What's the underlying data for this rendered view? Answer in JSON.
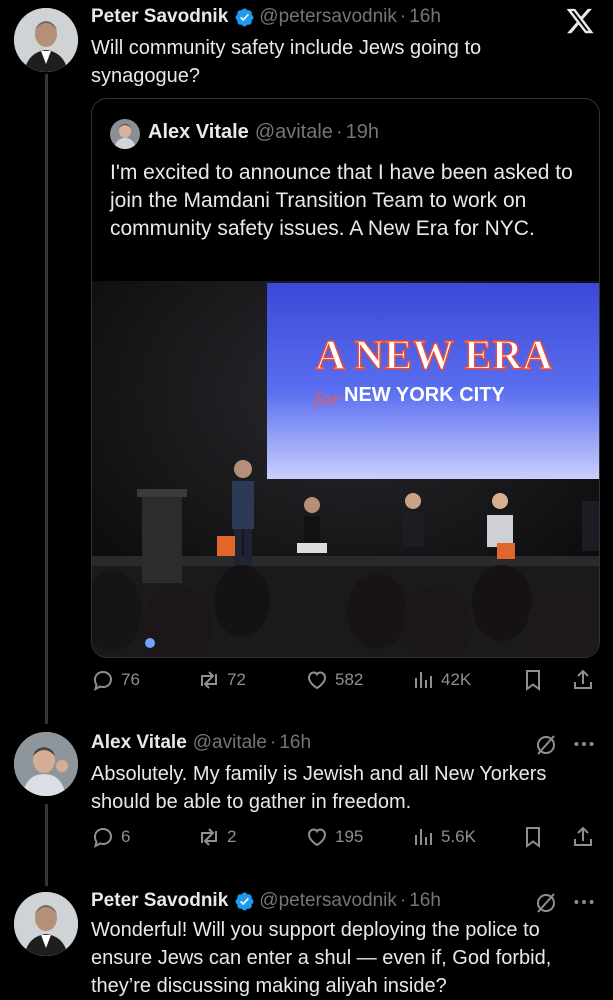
{
  "thread": {
    "main_post": {
      "author_name": "Peter Savodnik",
      "handle": "@petersavodnik",
      "separator": "·",
      "time": "16h",
      "text": "Will community safety include Jews going to synagogue?",
      "verified": true,
      "quoted_post": {
        "author_name": "Alex Vitale",
        "handle": "@avitale",
        "separator": "·",
        "time": "19h",
        "text": "I'm excited to announce that I have been asked to join the Mamdani Transition Team to work on community safety issues. A New Era for NYC.",
        "image": {
          "screen_headline": "A NEW ERA",
          "screen_script": "for",
          "screen_subline": "NEW YORK CITY"
        }
      },
      "stats": {
        "replies": "76",
        "reposts": "72",
        "likes": "582",
        "views": "42K"
      }
    },
    "reply_1": {
      "author_name": "Alex Vitale",
      "handle": "@avitale",
      "separator": "·",
      "time": "16h",
      "text": "Absolutely. My family is Jewish and all New Yorkers should be able to gather in freedom.",
      "stats": {
        "replies": "6",
        "reposts": "2",
        "likes": "195",
        "views": "5.6K"
      }
    },
    "reply_2": {
      "author_name": "Peter Savodnik",
      "handle": "@petersavodnik",
      "separator": "·",
      "time": "16h",
      "verified": true,
      "text": "Wonderful! Will you support deploying the police to ensure Jews can enter a shul — even if, God forbid, they’re discussing making aliyah inside?"
    }
  },
  "colors": {
    "background": "#000000",
    "text_primary": "#e7e9ea",
    "text_secondary": "#71767b",
    "verified_blue": "#1d9bf0",
    "border": "#2f3336"
  },
  "icons": [
    "x-logo-icon",
    "verified-icon",
    "reply-icon",
    "repost-icon",
    "like-icon",
    "views-icon",
    "bookmark-icon",
    "share-icon",
    "more-icon",
    "grok-icon"
  ]
}
